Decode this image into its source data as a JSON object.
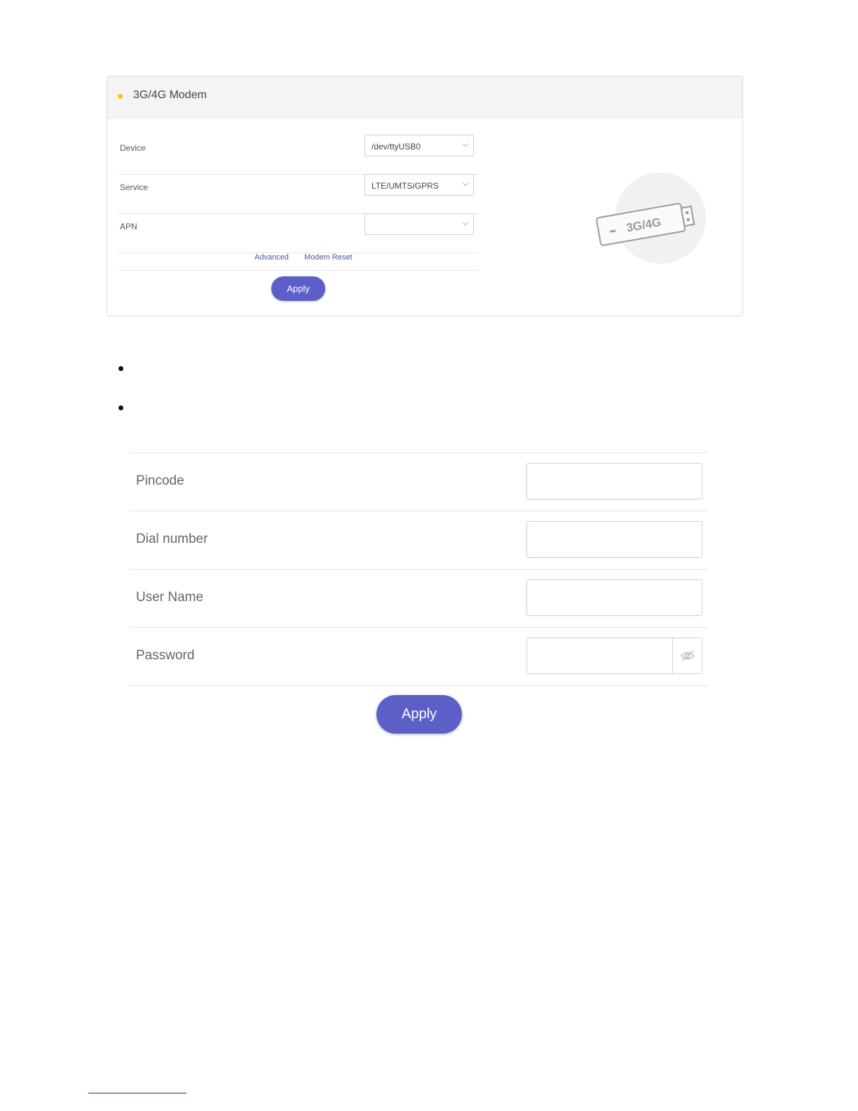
{
  "modem_panel": {
    "title": "3G/4G Modem",
    "rows": [
      {
        "label": "Device",
        "value": "/dev/ttyUSB0"
      },
      {
        "label": "Service",
        "value": "LTE/UMTS/GPRS"
      },
      {
        "label": "APN",
        "value": ""
      }
    ],
    "links": {
      "advanced": "Advanced",
      "modem_reset": "Modem Reset"
    },
    "apply_label": "Apply",
    "illustration_text": "3G/4G",
    "colors": {
      "accent_dot": "#f5c518",
      "button": "#5b5fc7",
      "link": "#4a5a9e"
    }
  },
  "advanced_form": {
    "fields": [
      {
        "label": "Pincode",
        "value": ""
      },
      {
        "label": "Dial number",
        "value": ""
      },
      {
        "label": "User Name",
        "value": ""
      },
      {
        "label": "Password",
        "value": ""
      }
    ],
    "password_toggle_icon": "eye-slash-icon",
    "apply_label": "Apply"
  }
}
